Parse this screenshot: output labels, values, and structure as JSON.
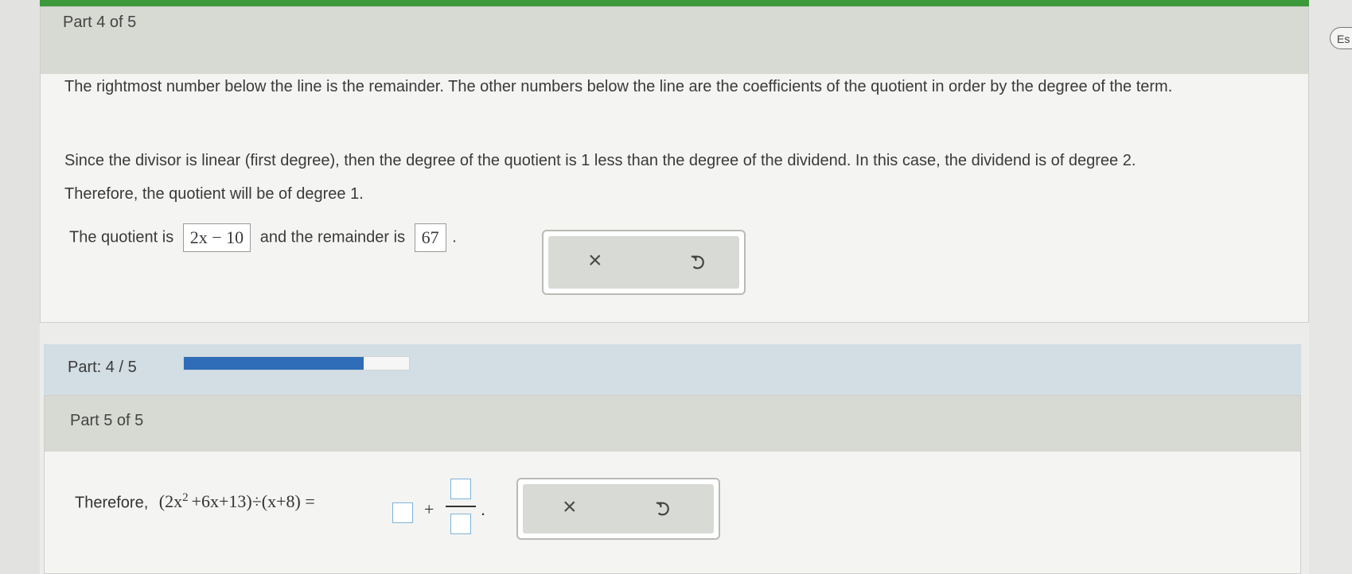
{
  "part4": {
    "header": "Part 4 of 5",
    "para1": "The rightmost number below the line is the remainder. The other numbers below the line are the coefficients of the quotient in order by the degree of the term.",
    "para2": "Since the divisor is linear (first degree), then the degree of the quotient is 1 less than the degree of the dividend. In this case, the dividend is of degree 2.",
    "para3": "Therefore, the quotient will be of degree 1.",
    "quotient_prefix": "The quotient is",
    "quotient_value": "2x − 10",
    "remainder_prefix": "and the remainder is",
    "remainder_value": "67",
    "period": "."
  },
  "progress": {
    "label": "Part: 4 / 5",
    "fraction": 0.8
  },
  "part5": {
    "header": "Part 5 of 5",
    "prefix": "Therefore,",
    "expression_start": "(2x",
    "exponent": "2",
    "expression_rest": "+6x+13)÷(x+8) =",
    "plus": "+",
    "period": "."
  },
  "tools": {
    "clear_glyph": "×",
    "undo_icon": "undo-icon"
  },
  "side": {
    "language_button": "Es"
  },
  "colors": {
    "progress_fill": "#2f6db8",
    "top_bar": "#3d9a3b"
  }
}
